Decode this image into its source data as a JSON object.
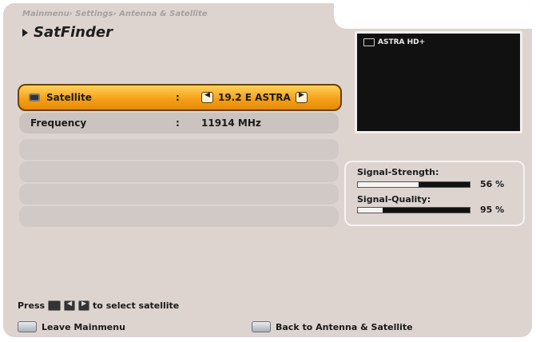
{
  "breadcrumb": "Mainmenu› Settings› Antenna & Satellite",
  "title": "SatFinder",
  "rows": [
    {
      "label": "Satellite",
      "sep": ":",
      "value": "19.2 E ASTRA",
      "selected": true
    },
    {
      "label": "Frequency",
      "sep": ":",
      "value": "11914 MHz",
      "selected": false
    }
  ],
  "preview": {
    "channel": "ASTRA HD+"
  },
  "signal": {
    "strength_label": "Signal-Strength:",
    "strength_pct": "56 %",
    "strength_value": 56,
    "quality_label": "Signal-Quality:",
    "quality_pct": "95 %",
    "quality_value": 95
  },
  "hint": {
    "press": "Press",
    "suffix": "to select satellite",
    "left_glyph": "◀",
    "right_glyph": "▶"
  },
  "footer": {
    "left": "Leave Mainmenu",
    "right": "Back to Antenna & Satellite"
  },
  "colors": {
    "accent": "#f6a11a",
    "panel": "#ddd4d0",
    "preview_bg": "#111111"
  }
}
